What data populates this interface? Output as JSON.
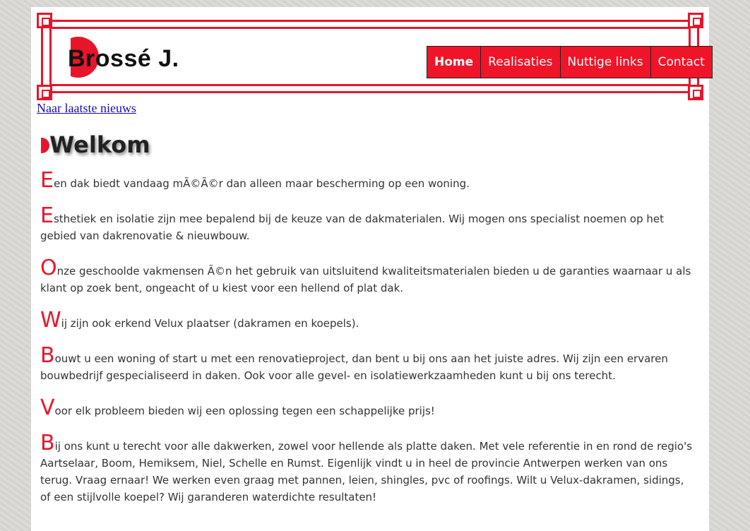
{
  "header": {
    "logo_text": "Brossé J.",
    "nav": [
      {
        "label": "Home",
        "active": true
      },
      {
        "label": "Realisaties",
        "active": false
      },
      {
        "label": "Nuttige links",
        "active": false
      },
      {
        "label": "Contact",
        "active": false
      }
    ]
  },
  "news_link": "Naar laatste nieuws",
  "welcome_title": "Welkom",
  "paragraphs": [
    {
      "initial": "E",
      "text": "en dak biedt vandaag mÃ©Ã©r dan alleen maar bescherming op een woning."
    },
    {
      "initial": "E",
      "text": "sthetiek en isolatie zijn mee bepalend bij de keuze van de dakmaterialen. Wij mogen ons specialist noemen op het gebied van dakrenovatie & nieuwbouw."
    },
    {
      "initial": "O",
      "text": "nze geschoolde vakmensen Ã©n het gebruik van uitsluitend kwaliteitsmaterialen bieden u de garanties waarnaar u als klant op zoek bent, ongeacht of u kiest voor een hellend of plat dak."
    },
    {
      "initial": "W",
      "text": "ij zijn ook erkend Velux plaatser (dakramen en koepels)."
    },
    {
      "initial": "B",
      "text": "ouwt u een woning of start u met een renovatieproject, dan bent u bij ons aan het juiste adres. Wij zijn een ervaren bouwbedrijf gespecialiseerd in daken. Ook voor alle gevel- en isolatiewerkzaamheden kunt u bij ons terecht."
    },
    {
      "initial": "V",
      "text": "oor elk probleem bieden wij een oplossing tegen een schappelijke prijs!"
    },
    {
      "initial": "B",
      "text": "ij ons kunt u terecht voor alle dakwerken, zowel voor hellende als platte daken. Met vele referentie in en rond de regio's Aartselaar, Boom, Hemiksem, Niel, Schelle en Rumst. Eigenlijk vindt u in heel de provincie Antwerpen werken van ons terug. Vraag ernaar! We werken even graag met pannen, leien, shingles, pvc of roofings. Wilt u Velux-dakramen, sidings, of een stijlvolle koepel? Wij garanderen waterdichte resultaten!"
    }
  ],
  "colors": {
    "accent": "#e8152a",
    "nav_bg": "#f01428",
    "link": "#1a0dab"
  }
}
